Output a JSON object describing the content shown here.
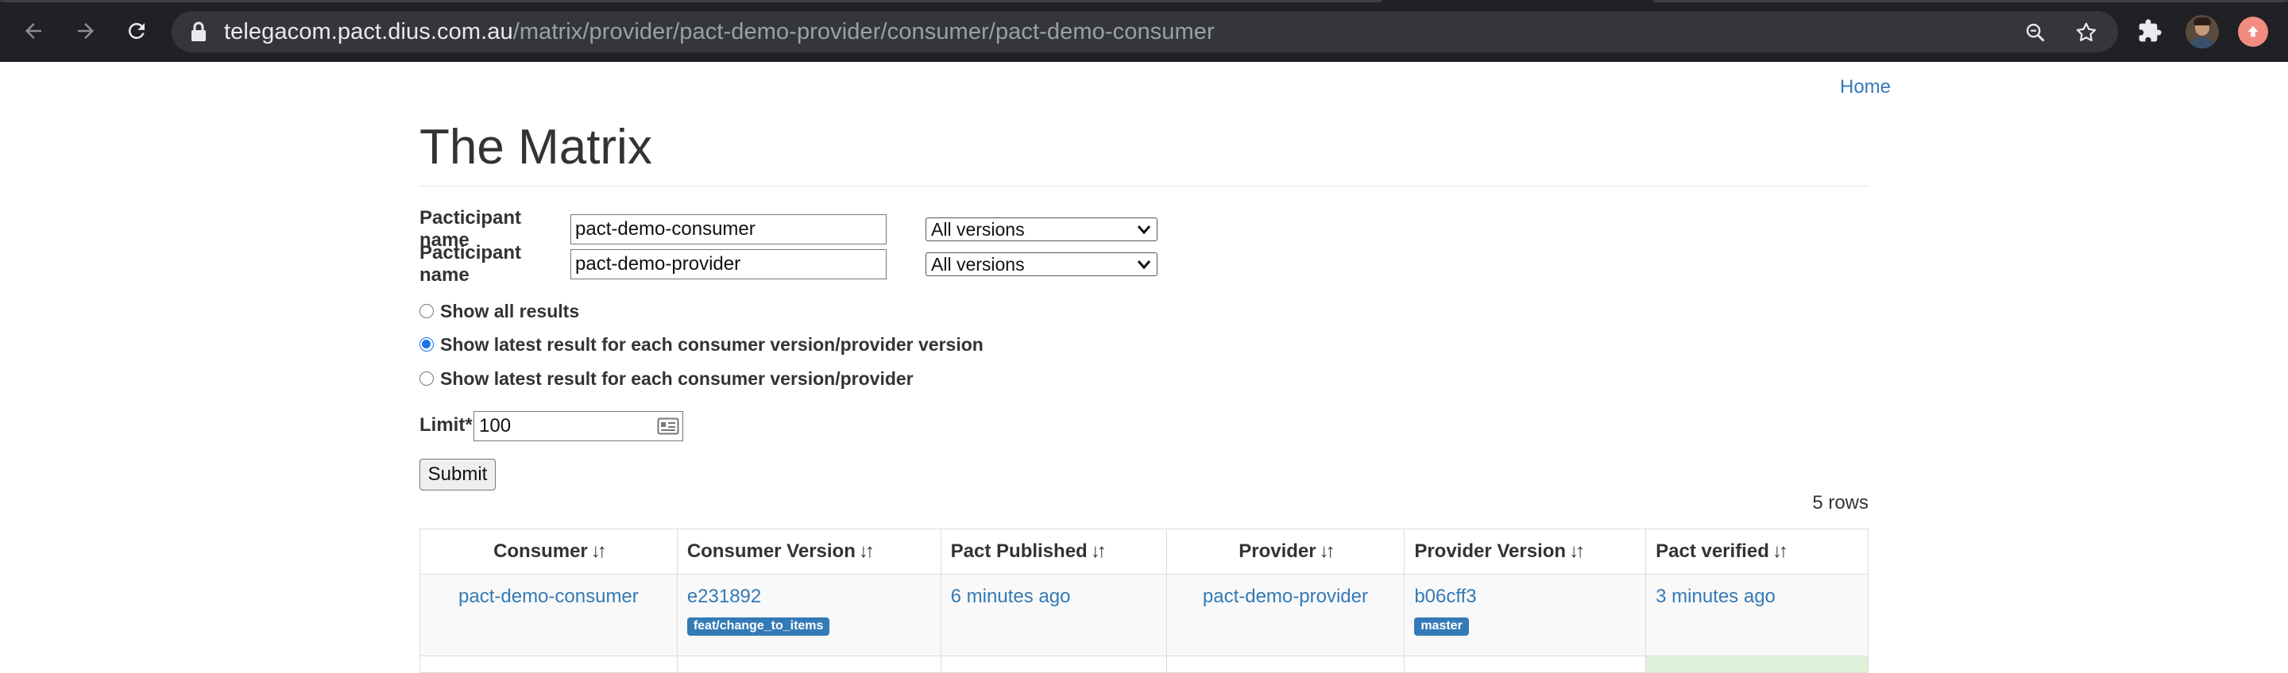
{
  "browser": {
    "url_host": "telegacom.pact.dius.com.au",
    "url_path": "/matrix/provider/pact-demo-provider/consumer/pact-demo-consumer",
    "icons": [
      "back-icon",
      "forward-icon",
      "reload-icon",
      "lock-icon",
      "zoom-icon",
      "star-icon",
      "extensions-icon",
      "profile-avatar",
      "update-icon"
    ]
  },
  "nav": {
    "home": "Home"
  },
  "page": {
    "title": "The Matrix"
  },
  "form": {
    "participants": [
      {
        "label": "Pacticipant name",
        "value": "pact-demo-consumer",
        "version_select": "All versions"
      },
      {
        "label": "Pacticipant name",
        "value": "pact-demo-provider",
        "version_select": "All versions"
      }
    ],
    "options": [
      {
        "label": "Show all results",
        "checked": false
      },
      {
        "label": "Show latest result for each consumer version/provider version",
        "checked": true
      },
      {
        "label": "Show latest result for each consumer version/provider",
        "checked": false
      }
    ],
    "limit_label": "Limit*",
    "limit_value": "100",
    "submit_label": "Submit"
  },
  "results": {
    "row_count": "5 rows",
    "columns": [
      "Consumer",
      "Consumer Version",
      "Pact Published",
      "Provider",
      "Provider Version",
      "Pact verified"
    ],
    "rows": [
      {
        "consumer": "pact-demo-consumer",
        "consumer_version": "e231892",
        "consumer_tag": "feat/change_to_items",
        "pact_published": "6 minutes ago",
        "provider": "pact-demo-provider",
        "provider_version": "b06cff3",
        "provider_tag": "master",
        "pact_verified": "3 minutes ago",
        "status": "failed"
      }
    ]
  },
  "colors": {
    "link": "#337ab7",
    "failed_bg": "#f2dede",
    "success_bg": "#dff0d8",
    "chrome_bg": "#202124",
    "omnibox_bg": "#35363a"
  }
}
